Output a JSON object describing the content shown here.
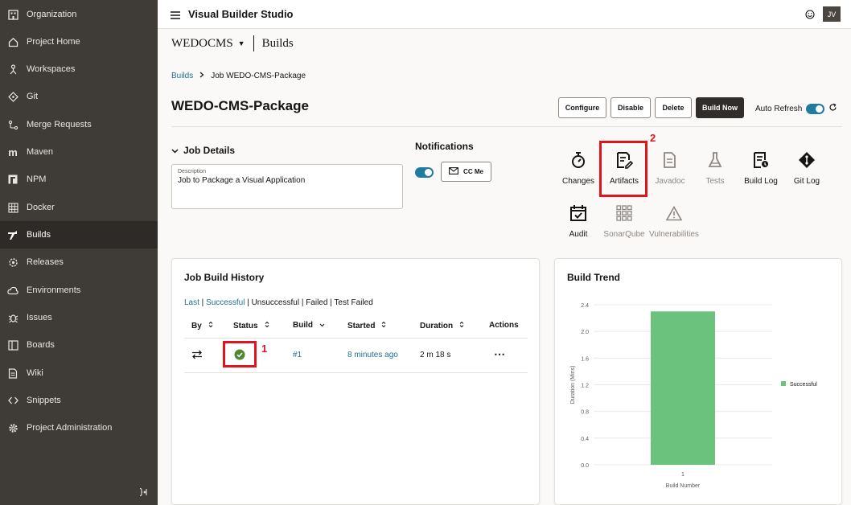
{
  "sidebar": {
    "items": [
      {
        "label": "Organization",
        "icon": "organization-icon"
      },
      {
        "label": "Project Home",
        "icon": "home-icon"
      },
      {
        "label": "Workspaces",
        "icon": "workspaces-icon"
      },
      {
        "label": "Git",
        "icon": "git-icon"
      },
      {
        "label": "Merge Requests",
        "icon": "merge-requests-icon"
      },
      {
        "label": "Maven",
        "icon": "maven-icon"
      },
      {
        "label": "NPM",
        "icon": "npm-icon"
      },
      {
        "label": "Docker",
        "icon": "docker-icon"
      },
      {
        "label": "Builds",
        "icon": "builds-icon",
        "active": true
      },
      {
        "label": "Releases",
        "icon": "releases-icon"
      },
      {
        "label": "Environments",
        "icon": "environments-icon"
      },
      {
        "label": "Issues",
        "icon": "issues-icon"
      },
      {
        "label": "Boards",
        "icon": "boards-icon"
      },
      {
        "label": "Wiki",
        "icon": "wiki-icon"
      },
      {
        "label": "Snippets",
        "icon": "snippets-icon"
      },
      {
        "label": "Project Administration",
        "icon": "gear-icon"
      }
    ]
  },
  "header": {
    "app_title": "Visual Builder Studio",
    "avatar_initials": "JV"
  },
  "project": {
    "name": "WEDOCMS",
    "section": "Builds"
  },
  "breadcrumb": {
    "root": "Builds",
    "current": "Job WEDO-CMS-Package"
  },
  "job": {
    "title": "WEDO-CMS-Package",
    "buttons": {
      "configure": "Configure",
      "disable": "Disable",
      "delete": "Delete",
      "build_now": "Build Now"
    },
    "auto_refresh_label": "Auto Refresh"
  },
  "details": {
    "heading": "Job Details",
    "description_label": "Description",
    "description_value": "Job to Package a Visual Application"
  },
  "notifications": {
    "heading": "Notifications",
    "cc_me": "CC Me"
  },
  "tools": [
    {
      "label": "Changes",
      "icon": "stopwatch-icon",
      "enabled": true
    },
    {
      "label": "Artifacts",
      "icon": "artifacts-icon",
      "enabled": true
    },
    {
      "label": "Javadoc",
      "icon": "javadoc-icon",
      "enabled": false
    },
    {
      "label": "Tests",
      "icon": "tests-flask-icon",
      "enabled": false
    },
    {
      "label": "Build Log",
      "icon": "build-log-icon",
      "enabled": true
    },
    {
      "label": "Git Log",
      "icon": "git-log-icon",
      "enabled": true
    },
    {
      "label": "Audit",
      "icon": "audit-icon",
      "enabled": true
    },
    {
      "label": "SonarQube",
      "icon": "sonarqube-grid-icon",
      "enabled": false
    },
    {
      "label": "Vulnerabilities",
      "icon": "warning-triangle-icon",
      "enabled": false
    }
  ],
  "annotations": {
    "first": "1",
    "second": "2"
  },
  "history": {
    "heading": "Job Build History",
    "filters": {
      "last": "Last",
      "sep1": " | ",
      "successful": "Successful",
      "rest": " | Unsuccessful | Failed | Test Failed"
    },
    "columns": [
      "By",
      "Status",
      "Build",
      "Started",
      "Duration",
      "Actions"
    ],
    "rows": [
      {
        "by_icon": "trigger-arrows-icon",
        "status_icon": "success-check-icon",
        "build": "#1",
        "started": "8 minutes ago",
        "duration": "2 m 18 s",
        "actions": "⋯"
      }
    ]
  },
  "trend": {
    "heading": "Build Trend"
  },
  "chart_data": {
    "type": "bar",
    "categories": [
      "1"
    ],
    "series": [
      {
        "name": "Successful",
        "values": [
          2.3
        ],
        "color": "#6ac27c"
      }
    ],
    "xlabel": "Build Number",
    "ylabel": "Duration (Mins)",
    "ylim": [
      0,
      2.4
    ],
    "yticks": [
      "0.0",
      "0.4",
      "0.8",
      "1.2",
      "1.6",
      "2.0",
      "2.4"
    ],
    "legend_position": "right"
  },
  "colors": {
    "accent": "#1f7c9e",
    "sidebar_bg": "#3f3b36",
    "highlight": "#e0141b",
    "success": "#4d8a2e"
  }
}
